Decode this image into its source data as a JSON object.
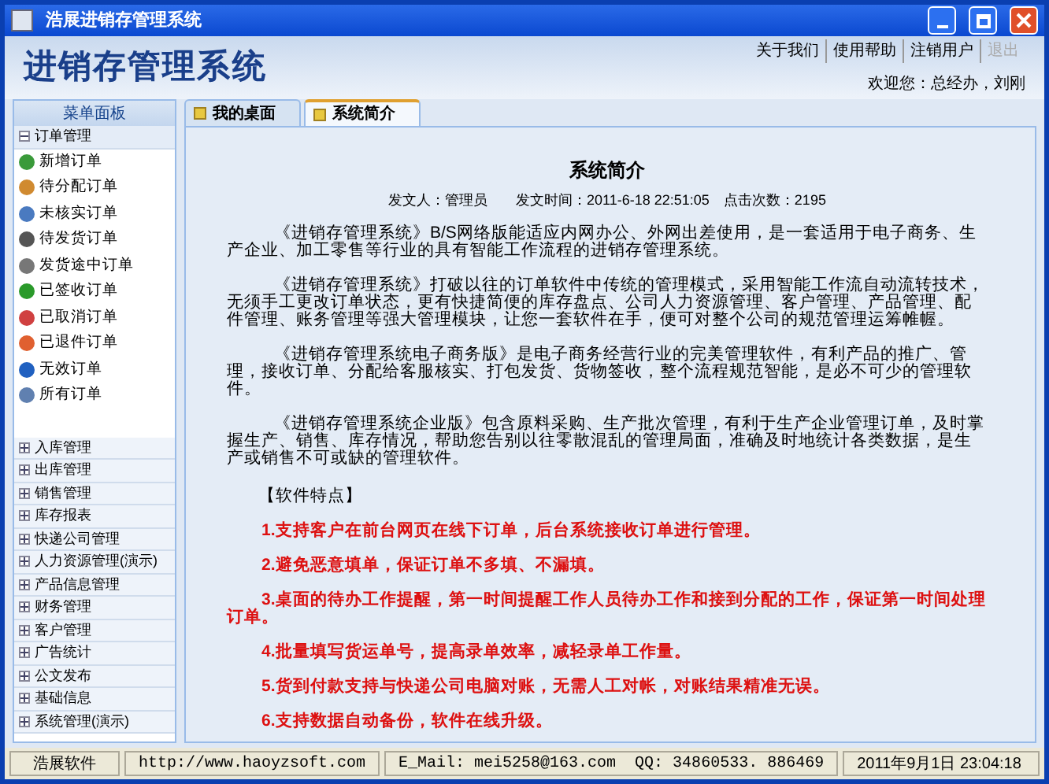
{
  "window": {
    "title": "浩展进销存管理系统"
  },
  "header": {
    "logo": "进销存管理系统",
    "links": [
      {
        "label": "关于我们",
        "disabled": false
      },
      {
        "label": "使用帮助",
        "disabled": false
      },
      {
        "label": "注销用户",
        "disabled": false
      },
      {
        "label": "退出",
        "disabled": true
      }
    ],
    "welcome": "欢迎您：总经办，刘刚"
  },
  "sidebar": {
    "title": "菜单面板",
    "groups": [
      {
        "label": "订单管理",
        "expanded": true,
        "children": [
          {
            "label": "新增订单"
          },
          {
            "label": "待分配订单"
          },
          {
            "label": "未核实订单"
          },
          {
            "label": "待发货订单"
          },
          {
            "label": "发货途中订单"
          },
          {
            "label": "已签收订单"
          },
          {
            "label": "已取消订单"
          },
          {
            "label": "已退件订单"
          },
          {
            "label": "无效订单"
          },
          {
            "label": "所有订单"
          }
        ]
      },
      {
        "label": "入库管理",
        "expanded": false
      },
      {
        "label": "出库管理",
        "expanded": false
      },
      {
        "label": "销售管理",
        "expanded": false
      },
      {
        "label": "库存报表",
        "expanded": false
      },
      {
        "label": "快递公司管理",
        "expanded": false
      },
      {
        "label": "人力资源管理(演示)",
        "expanded": false
      },
      {
        "label": "产品信息管理",
        "expanded": false
      },
      {
        "label": "财务管理",
        "expanded": false
      },
      {
        "label": "客户管理",
        "expanded": false
      },
      {
        "label": "广告统计",
        "expanded": false
      },
      {
        "label": "公文发布",
        "expanded": false
      },
      {
        "label": "基础信息",
        "expanded": false
      },
      {
        "label": "系统管理(演示)",
        "expanded": false
      }
    ]
  },
  "tabs": [
    {
      "label": "我的桌面",
      "selected": false
    },
    {
      "label": "系统简介",
      "selected": true
    }
  ],
  "article": {
    "title": "系统简介",
    "meta": "发文人：管理员　　发文时间：2011-6-18 22:51:05　点击次数：2195",
    "paragraphs": [
      "《进销存管理系统》B/S网络版能适应内网办公、外网出差使用，是一套适用于电子商务、生产企业、加工零售等行业的具有智能工作流程的进销存管理系统。",
      "《进销存管理系统》打破以往的订单软件中传统的管理模式，采用智能工作流自动流转技术，无须手工更改订单状态，更有快捷简便的库存盘点、公司人力资源管理、客户管理、产品管理、配件管理、账务管理等强大管理模块，让您一套软件在手，便可对整个公司的规范管理运筹帷幄。",
      "《进销存管理系统电子商务版》是电子商务经营行业的完美管理软件，有利产品的推广、管理，接收订单、分配给客服核实、打包发货、货物签收，整个流程规范智能，是必不可少的管理软件。",
      "《进销存管理系统企业版》包含原料采购、生产批次管理，有利于生产企业管理订单，及时掌握生产、销售、库存情况，帮助您告别以往零散混乱的管理局面，准确及时地统计各类数据，是生产或销售不可或缺的管理软件。"
    ],
    "features_heading": "【软件特点】",
    "features": [
      "1.支持客户在前台网页在线下订单，后台系统接收订单进行管理。",
      "2.避免恶意填单，保证订单不多填、不漏填。",
      "3.桌面的待办工作提醒，第一时间提醒工作人员待办工作和接到分配的工作，保证第一时间处理订单。",
      "4.批量填写货运单号，提高录单效率，减轻录单工作量。",
      "5.货到付款支持与快递公司电脑对账，无需人工对帐，对账结果精准无误。",
      "6.支持数据自动备份，软件在线升级。"
    ]
  },
  "status_bar": [
    "浩展软件",
    "http://www.haoyzsoft.com",
    "E_Mail: mei5258@163.com  QQ: 34860533. 886469",
    "2011年9月1日 23:04:18"
  ]
}
